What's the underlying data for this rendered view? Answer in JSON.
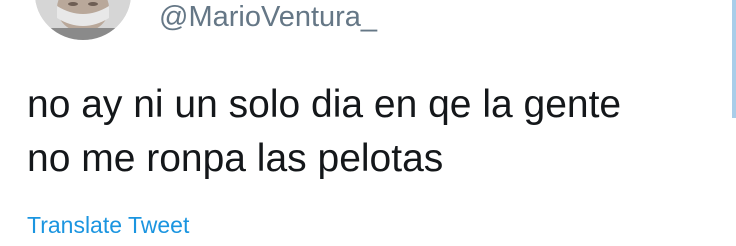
{
  "tweet": {
    "handle": "@MarioVentura_",
    "text": "no ay ni un solo dia en qe la gente\nno me ronpa las pelotas",
    "translate_label": "Translate Tweet"
  },
  "colors": {
    "handle": "#657786",
    "text": "#14171a",
    "link": "#1b95e0",
    "accent": "#a9cde9"
  },
  "icons": {
    "avatar": "profile-photo"
  }
}
